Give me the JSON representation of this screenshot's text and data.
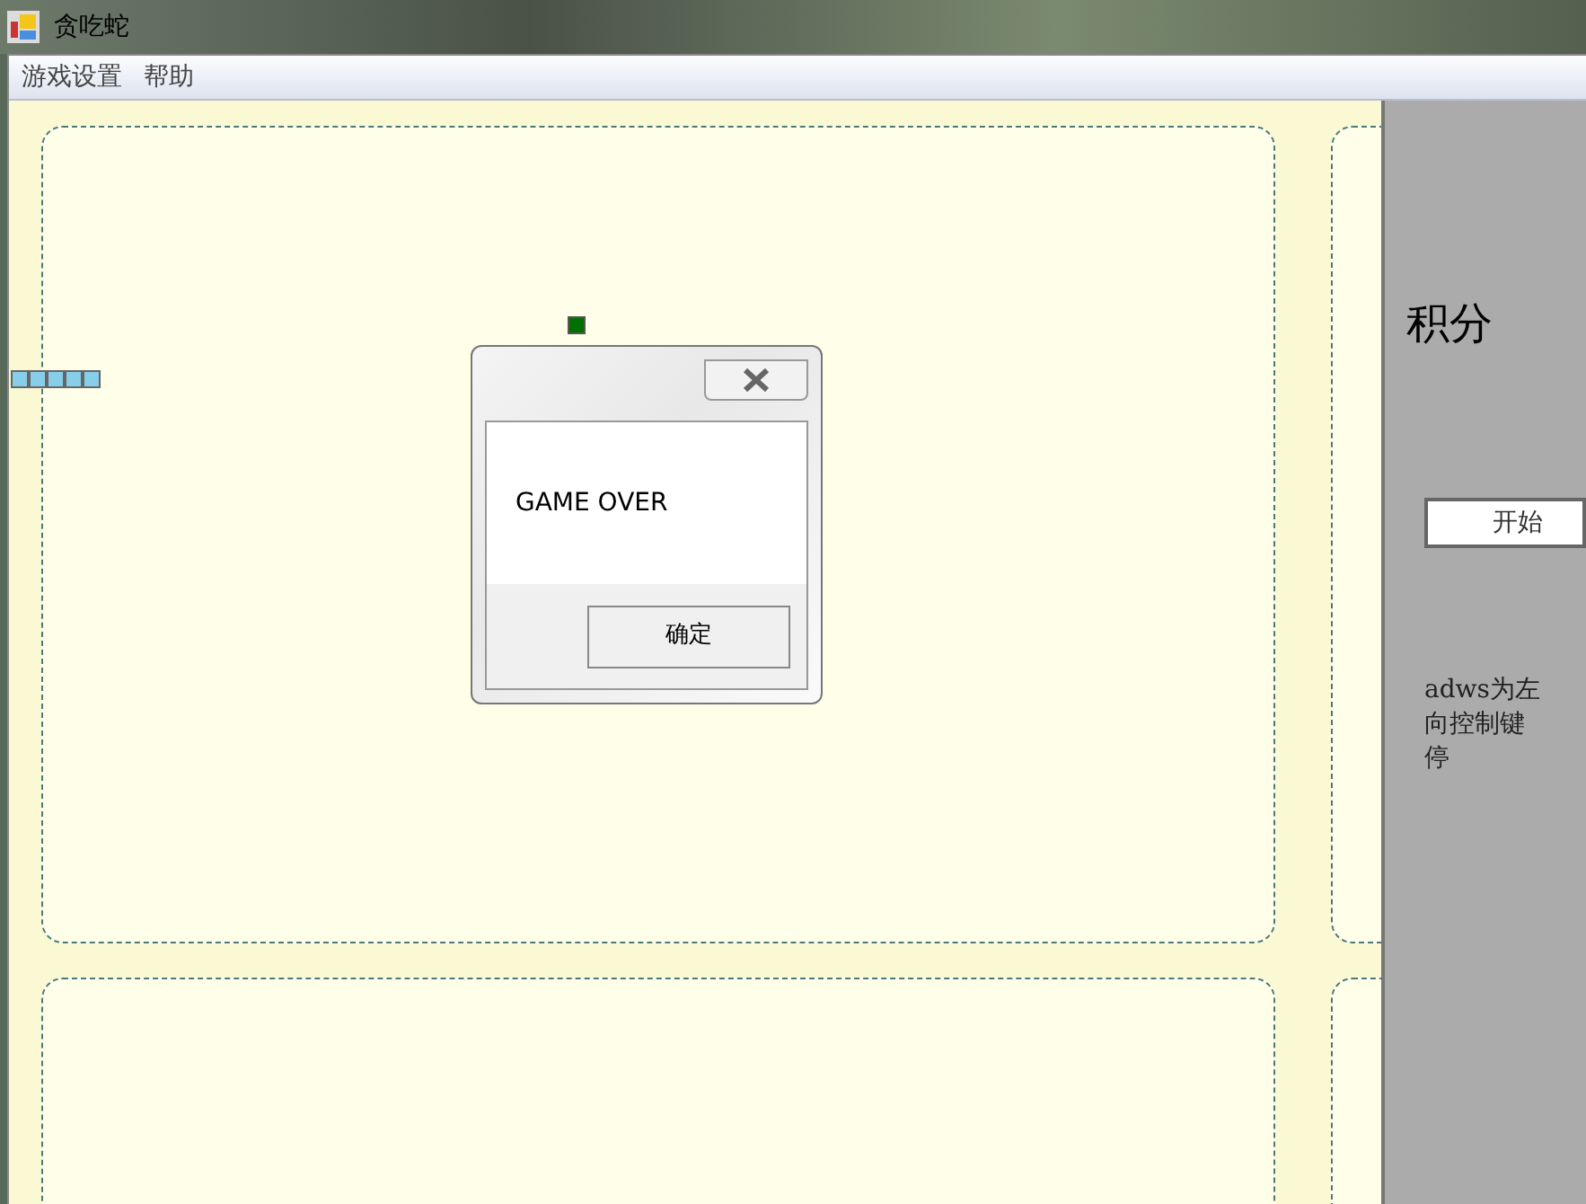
{
  "window": {
    "title": "贪吃蛇"
  },
  "menu": [
    "游戏设置",
    "帮助"
  ],
  "dialog": {
    "message": "GAME OVER",
    "button": "确定"
  },
  "side_panel": {
    "score_label": "积分",
    "start_button": "开始",
    "help_lines": [
      "adws为左",
      "向控制键",
      "停"
    ]
  }
}
